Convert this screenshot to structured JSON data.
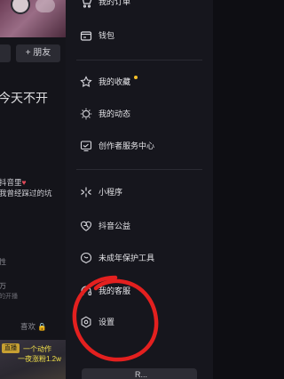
{
  "profile": {
    "friend_button": "+ 朋友",
    "motto": "今天不开",
    "bio_line1": "抖音里",
    "bio_heart": "♥",
    "bio_line2": "我曾经踩过的坑",
    "stat1": "性",
    "stat2": "万",
    "stat3": "的开播",
    "likes_tab": "喜欢",
    "likes_tab_mark": "🔒",
    "video_tag": "直播",
    "video_title1": "一个动作",
    "video_title2": "一夜涨粉1.2w"
  },
  "drawer": {
    "items": [
      {
        "label": "我的订单",
        "icon": "cart-icon"
      },
      {
        "label": "钱包",
        "icon": "wallet-icon"
      },
      {
        "label": "我的收藏",
        "icon": "star-icon",
        "badge_color": "#f6c12a"
      },
      {
        "label": "我的动态",
        "icon": "activity-icon"
      },
      {
        "label": "创作者服务中心",
        "icon": "creator-center-icon"
      },
      {
        "label": "小程序",
        "icon": "mini-program-icon"
      },
      {
        "label": "抖音公益",
        "icon": "charity-icon"
      },
      {
        "label": "未成年保护工具",
        "icon": "minor-protection-icon"
      },
      {
        "label": "我的客服",
        "icon": "headset-icon"
      },
      {
        "label": "设置",
        "icon": "settings-icon"
      }
    ],
    "bottom_button": "R..."
  },
  "colors": {
    "background": "#16161d",
    "annotation": "#e3201f",
    "badge": "#f6c12a"
  }
}
